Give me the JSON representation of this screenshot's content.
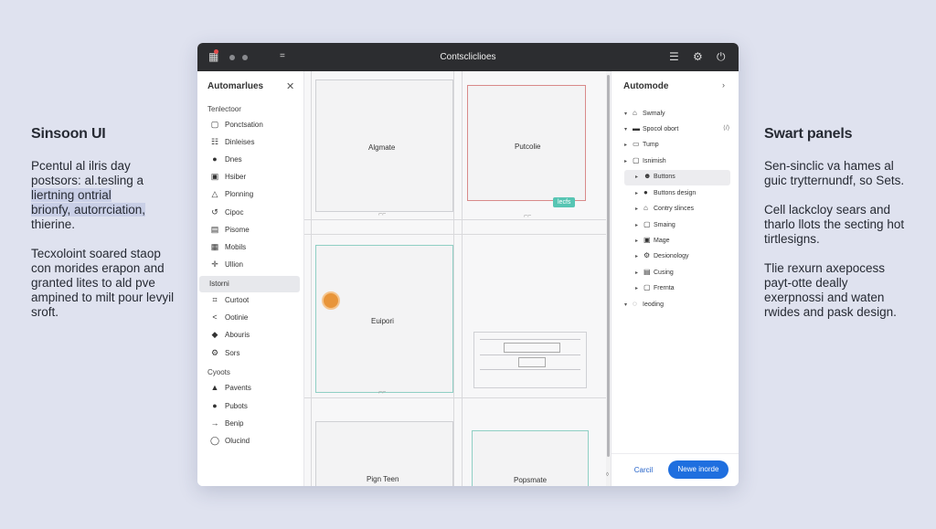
{
  "left_copy": {
    "heading": "Sinsoon UI",
    "para1_lines": [
      "Pcentul al ilris day",
      "postsors: al.tesling a",
      "liertning ontrial",
      "brionfy, autorrciation,",
      "thierine."
    ],
    "para2": "Tecxoloint soared staop con morides erapon and granted lites to ald pve ampined to milt pour levyil sroft."
  },
  "right_copy": {
    "heading": "Swart panels",
    "para1": "Sen-sinclic va hames al guic trytternundf, so Sets.",
    "para2": "Cell lackcloy sears and tharlo llots the secting hot tirtlesigns.",
    "para3": "Tlie rexurn axepocess payt-otte deally exerpnossi and waten rwides and pask design."
  },
  "window": {
    "title": "Contscliclioes",
    "icons": {
      "app": "grid-icon",
      "menu": "hamburger-icon",
      "settings": "settings-icon",
      "power": "power-icon"
    }
  },
  "left_panel": {
    "title": "Automarlues",
    "close_icon": "close-icon",
    "section_top": "Tenlectoor",
    "items_top": [
      {
        "icon": "page-icon",
        "label": "Ponctsation"
      },
      {
        "icon": "list-icon",
        "label": "Dinleises"
      },
      {
        "icon": "circle-icon",
        "label": "Dnes"
      },
      {
        "icon": "square-icon",
        "label": "Hsiber"
      },
      {
        "icon": "triangle-icon",
        "label": "Plonning"
      },
      {
        "icon": "refresh-icon",
        "label": "Cipoc"
      },
      {
        "icon": "stack-icon",
        "label": "Pisome"
      },
      {
        "icon": "grid-icon",
        "label": "Mobils"
      },
      {
        "icon": "move-icon",
        "label": "Ullion"
      }
    ],
    "active_section": "Istorni",
    "items_mid": [
      {
        "icon": "crop-icon",
        "label": "Curtoot"
      },
      {
        "icon": "share-icon",
        "label": "Ootinie"
      },
      {
        "icon": "diamond-icon",
        "label": "Abouris"
      },
      {
        "icon": "gear-icon",
        "label": "Sors"
      }
    ],
    "section_bottom": "Cyoots",
    "items_bottom": [
      {
        "icon": "upload-icon",
        "label": "Pavents"
      },
      {
        "icon": "dot-icon",
        "label": "Pubots"
      },
      {
        "icon": "arrow-icon",
        "label": "Benip"
      },
      {
        "icon": "oval-icon",
        "label": "Olucind"
      }
    ]
  },
  "canvas": {
    "frames": [
      {
        "label": "Algmate"
      },
      {
        "label": "Putcolie",
        "tag": "lecfs"
      },
      {
        "label": "Euipori"
      },
      {
        "label": ""
      },
      {
        "label": "Pign Teen"
      },
      {
        "label": "Popsmate"
      }
    ]
  },
  "right_panel": {
    "title": "Automode",
    "tree": [
      {
        "label": "Swmaly",
        "icon": "lock-icon",
        "arrow": "down"
      },
      {
        "label": "Spocol obort",
        "icon": "monitor-icon",
        "arrow": "down",
        "aside": "⟨/⟩"
      },
      {
        "label": "Tump",
        "icon": "frame-icon",
        "arrow": "right"
      },
      {
        "label": "Isnimish",
        "icon": "frame-icon",
        "arrow": "right"
      },
      {
        "label": "Buttons",
        "icon": "cursor-icon",
        "arrow": "right",
        "selected": true
      },
      {
        "label": "Buttons design",
        "icon": "dot-icon",
        "arrow": "right"
      },
      {
        "label": "Contry slinces",
        "icon": "lock-icon",
        "arrow": "right"
      },
      {
        "label": "Smaing",
        "icon": "frame-icon",
        "arrow": "right"
      },
      {
        "label": "Mage",
        "icon": "image-icon",
        "arrow": "right"
      },
      {
        "label": "Desionology",
        "icon": "cog-icon",
        "arrow": "right"
      },
      {
        "label": "Cusing",
        "icon": "book-icon",
        "arrow": "right"
      },
      {
        "label": "Frernta",
        "icon": "frame-icon",
        "arrow": "right"
      },
      {
        "label": "Ieoding",
        "icon": "chat-icon",
        "arrow": "down"
      }
    ],
    "cancel_label": "Carcil",
    "primary_label": "Newe inorde"
  }
}
